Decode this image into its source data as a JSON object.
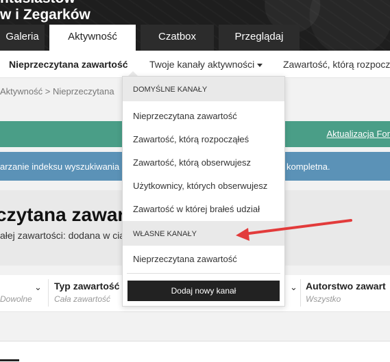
{
  "header": {
    "title_line1": "ntusiastów",
    "title_line2": "w i Zegarków",
    "tabs": [
      {
        "label": "Galeria"
      },
      {
        "label": "Aktywność"
      },
      {
        "label": "Czatbox"
      },
      {
        "label": "Przeglądaj"
      }
    ]
  },
  "subnav": {
    "item_unread": "Nieprzeczytana zawartość",
    "item_streams": "Twoje kanały aktywności",
    "item_started": "Zawartość, którą rozpoczą"
  },
  "breadcrumb": {
    "home": "Aktywność",
    "separator": ">",
    "current": "Nieprzeczytana"
  },
  "banner": {
    "green_link": "Aktualizacja For",
    "blue_text_left": "arzanie indeksu wyszukiwania",
    "blue_text_right": "kompletna."
  },
  "page": {
    "title": "czytana zawart",
    "subtitle": "ałej zawartości: dodana w cia"
  },
  "filters": [
    {
      "label": "",
      "value": "Dowolne"
    },
    {
      "label": "Typ zawartość",
      "value": "Cała zawartość"
    },
    {
      "label": "Autorstwo zawart",
      "value": "Wszystko"
    }
  ],
  "dropdown": {
    "default_header": "Domyślne kanały",
    "default_items": [
      "Nieprzeczytana zawartość",
      "Zawartość, którą rozpocząłeś",
      "Zawartość, którą obserwujesz",
      "Użytkownicy, których obserwujesz",
      "Zawartość w której brałeś udział"
    ],
    "custom_header": "Własne kanały",
    "custom_items": [
      "Nieprzeczytana zawartość"
    ],
    "add_button": "Dodaj nowy kanał"
  },
  "colors": {
    "header_bg": "#1e1e1e",
    "green_bar": "#4a9e87",
    "blue_bar": "#5b92b7",
    "annotation_arrow": "#e23b3b"
  }
}
